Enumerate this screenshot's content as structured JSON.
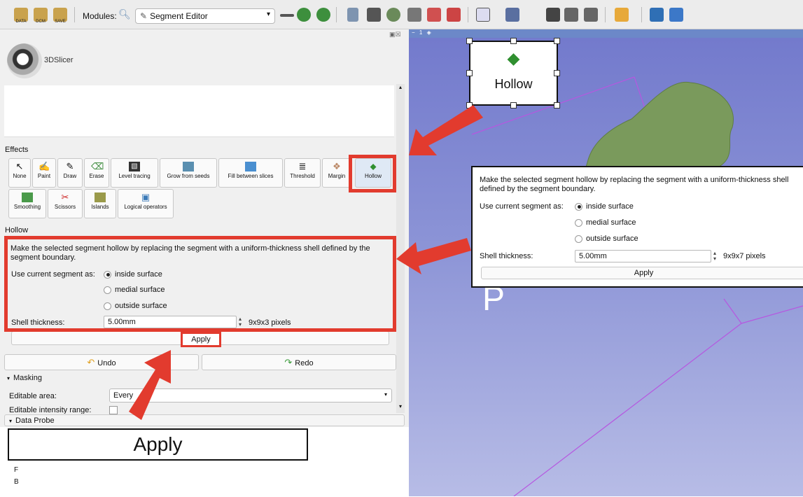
{
  "toolbar": {
    "data_label": "DATA",
    "dcm_label": "DCM",
    "save_label": "SAVE",
    "modules_label": "Modules:",
    "module_selected": "Segment Editor"
  },
  "logo": {
    "text": "3DSlicer"
  },
  "effects": {
    "label": "Effects",
    "row1": [
      "None",
      "Paint",
      "Draw",
      "Erase",
      "Level tracing",
      "Grow from seeds",
      "Fill between slices",
      "Threshold",
      "Margin",
      "Hollow"
    ],
    "row2": [
      "Smoothing",
      "Scissors",
      "Islands",
      "Logical operators"
    ]
  },
  "hollow": {
    "section_title": "Hollow",
    "description": "Make the selected segment hollow by replacing the segment with a uniform-thickness shell defined by the segment boundary.",
    "use_current_label": "Use current segment as:",
    "options": [
      "inside surface",
      "medial surface",
      "outside surface"
    ],
    "shell_label": "Shell thickness:",
    "shell_value": "5.00mm",
    "shell_pixels": "9x9x3 pixels",
    "apply": "Apply"
  },
  "undo": "Undo",
  "redo": "Redo",
  "masking": {
    "header": "Masking",
    "editable_area_label": "Editable area:",
    "editable_area_value": "Every",
    "intensity_label": "Editable intensity range:"
  },
  "data_probe": {
    "header": "Data Probe",
    "f": "F",
    "b": "B"
  },
  "callouts": {
    "apply_big": "Apply",
    "hollow_icon_label": "Hollow",
    "zoom_description": "Make the selected segment hollow by replacing the segment with a uniform-thickness shell defined by the segment boundary.",
    "zoom_use_current_label": "Use current segment as:",
    "zoom_options": [
      "inside surface",
      "medial surface",
      "outside surface"
    ],
    "zoom_shell_label": "Shell thickness:",
    "zoom_shell_value": "5.00mm",
    "zoom_shell_pixels": "9x9x7 pixels",
    "zoom_apply": "Apply"
  },
  "view3d": {
    "tab": "1",
    "orientation_letter": "P"
  },
  "colors": {
    "annotation_red": "#e23b2e",
    "view_bg": "#7c83d0",
    "model_green": "#7a9a5c"
  }
}
